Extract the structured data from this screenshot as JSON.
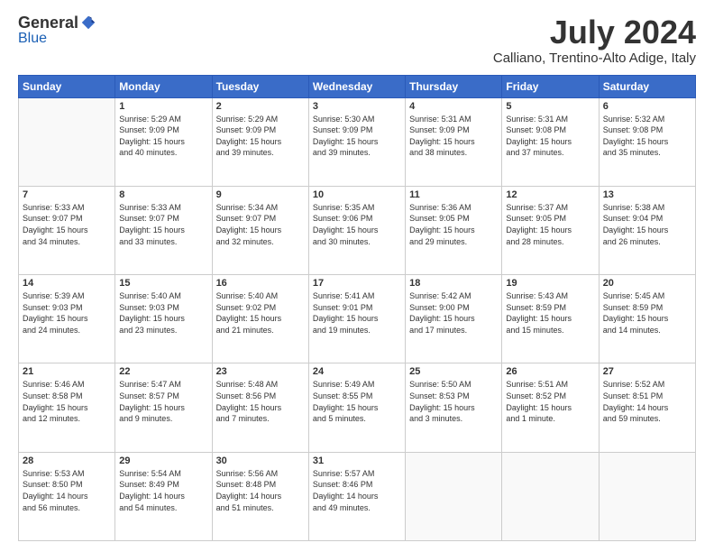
{
  "logo": {
    "general": "General",
    "blue": "Blue"
  },
  "title": "July 2024",
  "subtitle": "Calliano, Trentino-Alto Adige, Italy",
  "days_header": [
    "Sunday",
    "Monday",
    "Tuesday",
    "Wednesday",
    "Thursday",
    "Friday",
    "Saturday"
  ],
  "weeks": [
    [
      {
        "day": "",
        "info": ""
      },
      {
        "day": "1",
        "info": "Sunrise: 5:29 AM\nSunset: 9:09 PM\nDaylight: 15 hours\nand 40 minutes."
      },
      {
        "day": "2",
        "info": "Sunrise: 5:29 AM\nSunset: 9:09 PM\nDaylight: 15 hours\nand 39 minutes."
      },
      {
        "day": "3",
        "info": "Sunrise: 5:30 AM\nSunset: 9:09 PM\nDaylight: 15 hours\nand 39 minutes."
      },
      {
        "day": "4",
        "info": "Sunrise: 5:31 AM\nSunset: 9:09 PM\nDaylight: 15 hours\nand 38 minutes."
      },
      {
        "day": "5",
        "info": "Sunrise: 5:31 AM\nSunset: 9:08 PM\nDaylight: 15 hours\nand 37 minutes."
      },
      {
        "day": "6",
        "info": "Sunrise: 5:32 AM\nSunset: 9:08 PM\nDaylight: 15 hours\nand 35 minutes."
      }
    ],
    [
      {
        "day": "7",
        "info": "Sunrise: 5:33 AM\nSunset: 9:07 PM\nDaylight: 15 hours\nand 34 minutes."
      },
      {
        "day": "8",
        "info": "Sunrise: 5:33 AM\nSunset: 9:07 PM\nDaylight: 15 hours\nand 33 minutes."
      },
      {
        "day": "9",
        "info": "Sunrise: 5:34 AM\nSunset: 9:07 PM\nDaylight: 15 hours\nand 32 minutes."
      },
      {
        "day": "10",
        "info": "Sunrise: 5:35 AM\nSunset: 9:06 PM\nDaylight: 15 hours\nand 30 minutes."
      },
      {
        "day": "11",
        "info": "Sunrise: 5:36 AM\nSunset: 9:05 PM\nDaylight: 15 hours\nand 29 minutes."
      },
      {
        "day": "12",
        "info": "Sunrise: 5:37 AM\nSunset: 9:05 PM\nDaylight: 15 hours\nand 28 minutes."
      },
      {
        "day": "13",
        "info": "Sunrise: 5:38 AM\nSunset: 9:04 PM\nDaylight: 15 hours\nand 26 minutes."
      }
    ],
    [
      {
        "day": "14",
        "info": "Sunrise: 5:39 AM\nSunset: 9:03 PM\nDaylight: 15 hours\nand 24 minutes."
      },
      {
        "day": "15",
        "info": "Sunrise: 5:40 AM\nSunset: 9:03 PM\nDaylight: 15 hours\nand 23 minutes."
      },
      {
        "day": "16",
        "info": "Sunrise: 5:40 AM\nSunset: 9:02 PM\nDaylight: 15 hours\nand 21 minutes."
      },
      {
        "day": "17",
        "info": "Sunrise: 5:41 AM\nSunset: 9:01 PM\nDaylight: 15 hours\nand 19 minutes."
      },
      {
        "day": "18",
        "info": "Sunrise: 5:42 AM\nSunset: 9:00 PM\nDaylight: 15 hours\nand 17 minutes."
      },
      {
        "day": "19",
        "info": "Sunrise: 5:43 AM\nSunset: 8:59 PM\nDaylight: 15 hours\nand 15 minutes."
      },
      {
        "day": "20",
        "info": "Sunrise: 5:45 AM\nSunset: 8:59 PM\nDaylight: 15 hours\nand 14 minutes."
      }
    ],
    [
      {
        "day": "21",
        "info": "Sunrise: 5:46 AM\nSunset: 8:58 PM\nDaylight: 15 hours\nand 12 minutes."
      },
      {
        "day": "22",
        "info": "Sunrise: 5:47 AM\nSunset: 8:57 PM\nDaylight: 15 hours\nand 9 minutes."
      },
      {
        "day": "23",
        "info": "Sunrise: 5:48 AM\nSunset: 8:56 PM\nDaylight: 15 hours\nand 7 minutes."
      },
      {
        "day": "24",
        "info": "Sunrise: 5:49 AM\nSunset: 8:55 PM\nDaylight: 15 hours\nand 5 minutes."
      },
      {
        "day": "25",
        "info": "Sunrise: 5:50 AM\nSunset: 8:53 PM\nDaylight: 15 hours\nand 3 minutes."
      },
      {
        "day": "26",
        "info": "Sunrise: 5:51 AM\nSunset: 8:52 PM\nDaylight: 15 hours\nand 1 minute."
      },
      {
        "day": "27",
        "info": "Sunrise: 5:52 AM\nSunset: 8:51 PM\nDaylight: 14 hours\nand 59 minutes."
      }
    ],
    [
      {
        "day": "28",
        "info": "Sunrise: 5:53 AM\nSunset: 8:50 PM\nDaylight: 14 hours\nand 56 minutes."
      },
      {
        "day": "29",
        "info": "Sunrise: 5:54 AM\nSunset: 8:49 PM\nDaylight: 14 hours\nand 54 minutes."
      },
      {
        "day": "30",
        "info": "Sunrise: 5:56 AM\nSunset: 8:48 PM\nDaylight: 14 hours\nand 51 minutes."
      },
      {
        "day": "31",
        "info": "Sunrise: 5:57 AM\nSunset: 8:46 PM\nDaylight: 14 hours\nand 49 minutes."
      },
      {
        "day": "",
        "info": ""
      },
      {
        "day": "",
        "info": ""
      },
      {
        "day": "",
        "info": ""
      }
    ]
  ]
}
